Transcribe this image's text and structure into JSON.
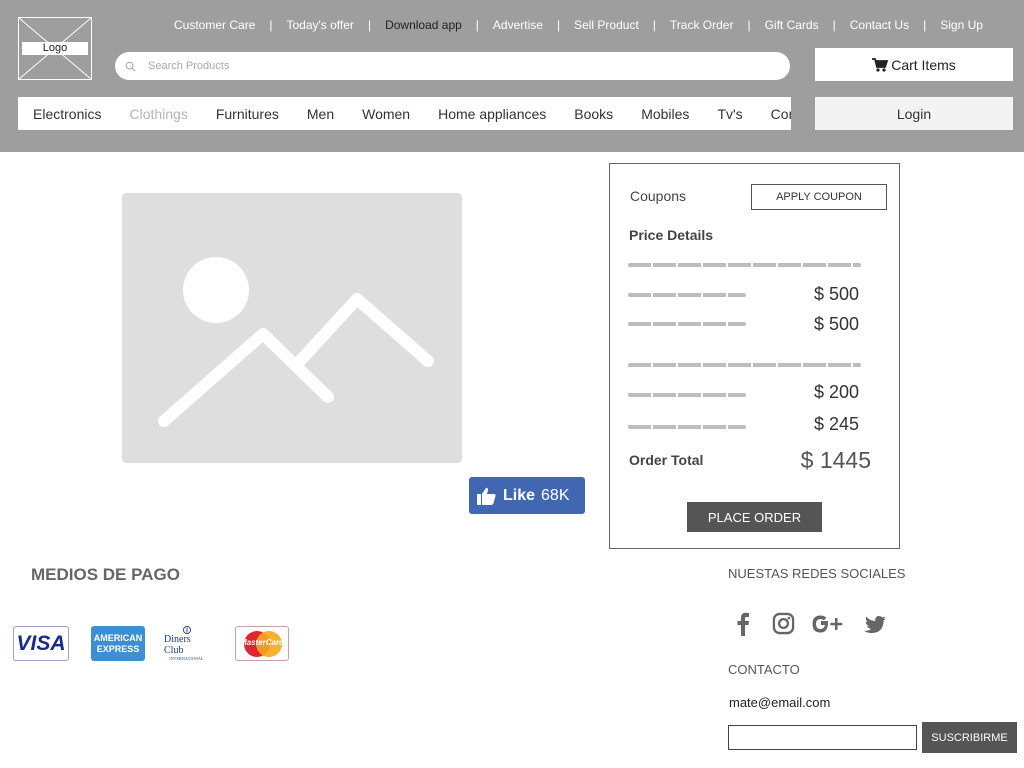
{
  "header": {
    "logo_label": "Logo",
    "top_links": [
      {
        "label": "Customer Care"
      },
      {
        "label": "Today's offer"
      },
      {
        "label": "Download app"
      },
      {
        "label": "Advertise"
      },
      {
        "label": "Sell Product"
      },
      {
        "label": "Track Order"
      },
      {
        "label": "Gift Cards"
      },
      {
        "label": "Contact Us"
      },
      {
        "label": "Sign Up"
      }
    ],
    "search_placeholder": "Search Products",
    "cart_label": "Cart Items",
    "login_label": "Login",
    "nav": [
      {
        "label": "Electronics"
      },
      {
        "label": "Clothings"
      },
      {
        "label": "Furnitures"
      },
      {
        "label": "Men"
      },
      {
        "label": "Women"
      },
      {
        "label": "Home appliances"
      },
      {
        "label": "Books"
      },
      {
        "label": "Mobiles"
      },
      {
        "label": "Tv's"
      },
      {
        "label": "Computers"
      }
    ]
  },
  "product": {
    "like_label": "Like",
    "like_count": "68K"
  },
  "order": {
    "coupons_label": "Coupons",
    "apply_coupon_label": "APPLY COUPON",
    "price_details_title": "Price Details",
    "prices": [
      "$ 500",
      "$ 500",
      "$ 200",
      "$ 245"
    ],
    "order_total_label": "Order Total",
    "order_total_value": "$ 1445",
    "place_order_label": "PLACE ORDER"
  },
  "footer": {
    "payment_title": "MEDIOS DE PAGO",
    "cards": {
      "visa": "VISA",
      "amex_line1": "AMERICAN",
      "amex_line2": "EXPRESS",
      "diners": "Diners Club",
      "diners_sub": "INTERNATIONAL",
      "mastercard": "MasterCard"
    },
    "social_title": "NUESTAS REDES SOCIALES",
    "contact_title": "CONTACTO",
    "contact_email": "mate@email.com",
    "subscribe_label": "SUSCRIBIRME"
  },
  "colors": {
    "header_bg": "#9e9e9e",
    "facebook_blue": "#4267b2",
    "button_dark": "#555555"
  }
}
